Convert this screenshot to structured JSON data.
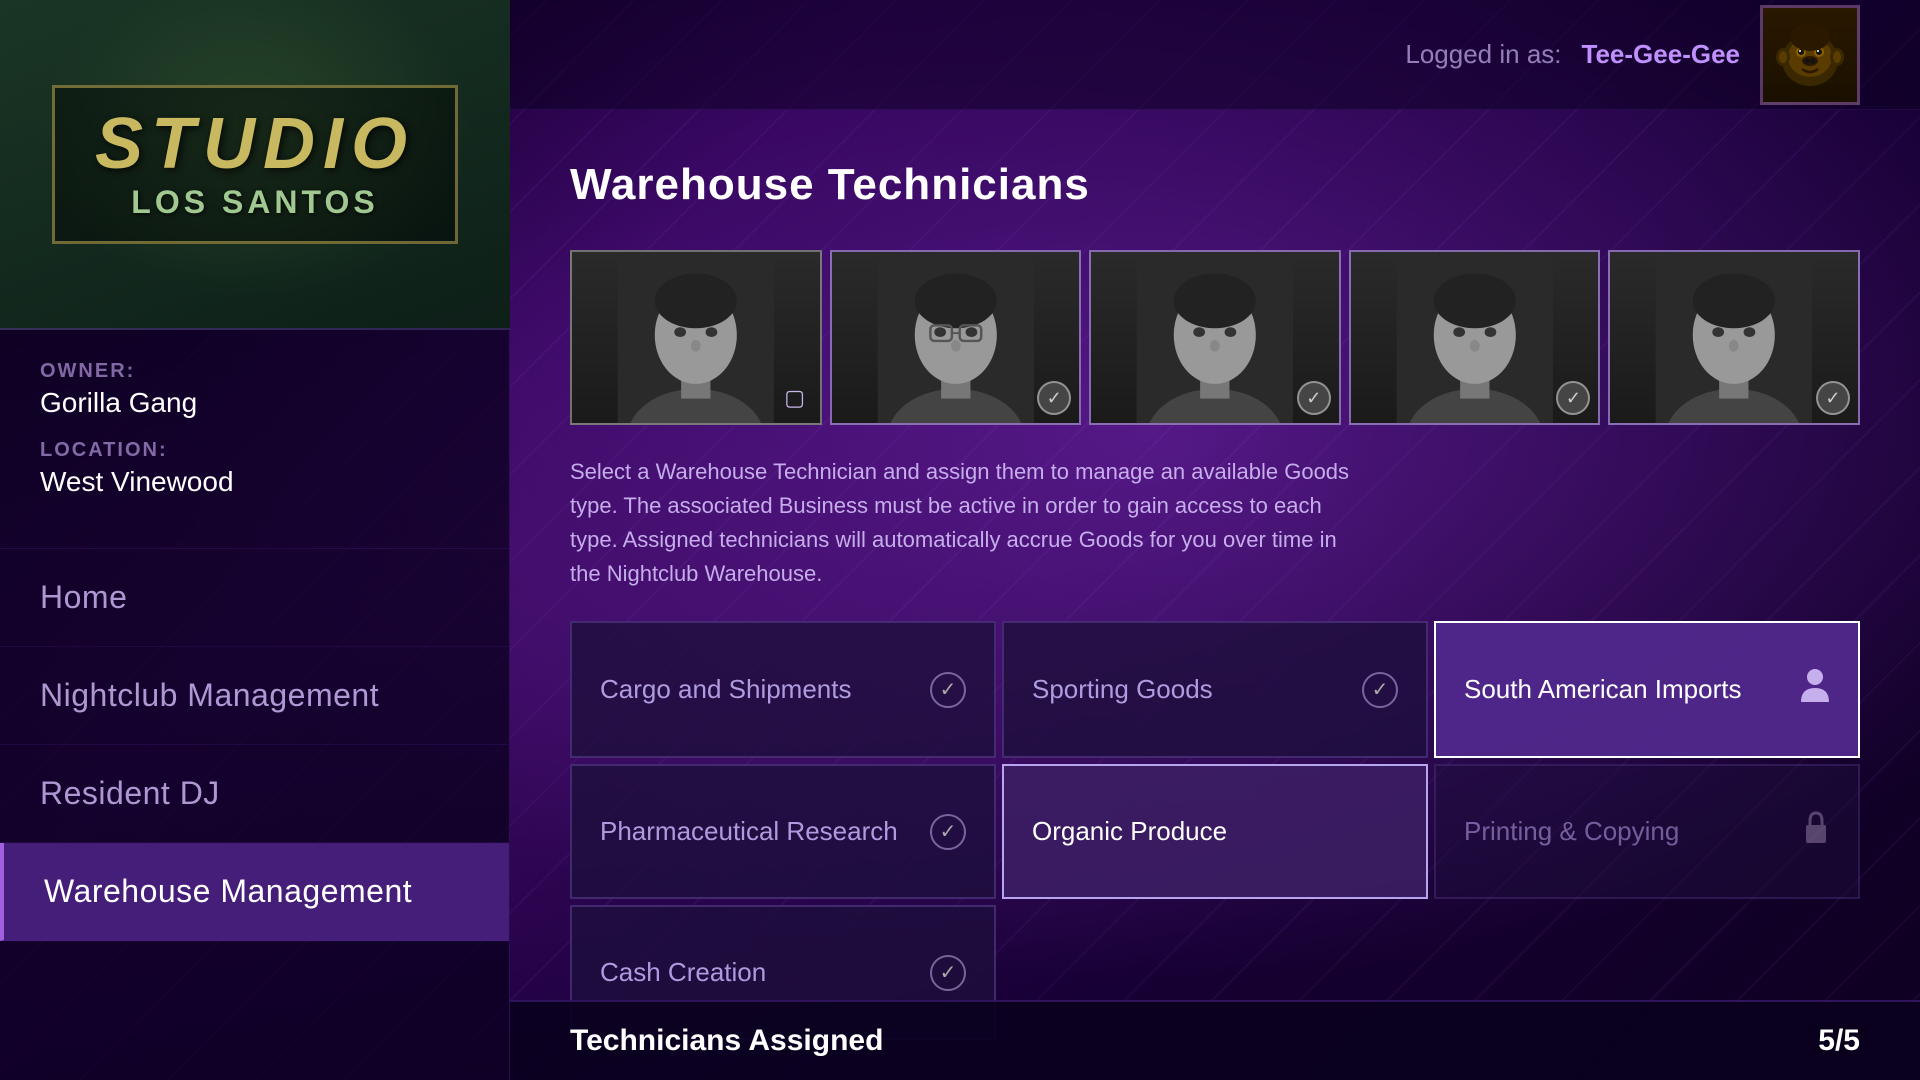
{
  "background": {
    "color": "#1a0a2e"
  },
  "header": {
    "logged_in_label": "Logged in as:",
    "username": "Tee-Gee-Gee"
  },
  "sidebar": {
    "studio": {
      "name": "STUDIO",
      "location_subtitle": "LOS SANTOS"
    },
    "owner_label": "OWNER:",
    "owner_name": "Gorilla Gang",
    "location_label": "LOCATION:",
    "location_name": "West Vinewood",
    "nav_items": [
      {
        "id": "home",
        "label": "Home",
        "active": false
      },
      {
        "id": "nightclub-management",
        "label": "Nightclub Management",
        "active": false
      },
      {
        "id": "resident-dj",
        "label": "Resident DJ",
        "active": false
      },
      {
        "id": "warehouse-management",
        "label": "Warehouse Management",
        "active": true
      }
    ]
  },
  "main": {
    "title": "Warehouse Technicians",
    "technicians": [
      {
        "id": 1,
        "status": "available",
        "badge": "person"
      },
      {
        "id": 2,
        "status": "assigned",
        "badge": "check"
      },
      {
        "id": 3,
        "status": "assigned",
        "badge": "check"
      },
      {
        "id": 4,
        "status": "assigned",
        "badge": "check"
      },
      {
        "id": 5,
        "status": "assigned",
        "badge": "check"
      }
    ],
    "description": "Select a Warehouse Technician and assign them to manage an available Goods type. The associated Business must be active in order to gain access to each type. Assigned technicians will automatically accrue Goods for you over time in the Nightclub Warehouse.",
    "goods": [
      {
        "id": "cargo",
        "name": "Cargo and Shipments",
        "icon": "check",
        "state": "checked"
      },
      {
        "id": "sporting",
        "name": "Sporting Goods",
        "icon": "check",
        "state": "checked"
      },
      {
        "id": "south-american",
        "name": "South American Imports",
        "icon": "person",
        "state": "selected"
      },
      {
        "id": "pharmaceutical",
        "name": "Pharmaceutical Research",
        "icon": "check",
        "state": "checked"
      },
      {
        "id": "organic",
        "name": "Organic Produce",
        "icon": "",
        "state": "active"
      },
      {
        "id": "printing",
        "name": "Printing & Copying",
        "icon": "lock",
        "state": "locked"
      },
      {
        "id": "cash",
        "name": "Cash Creation",
        "icon": "check",
        "state": "checked"
      }
    ],
    "technicians_assigned_label": "Technicians Assigned",
    "technicians_assigned_count": "5/5"
  }
}
